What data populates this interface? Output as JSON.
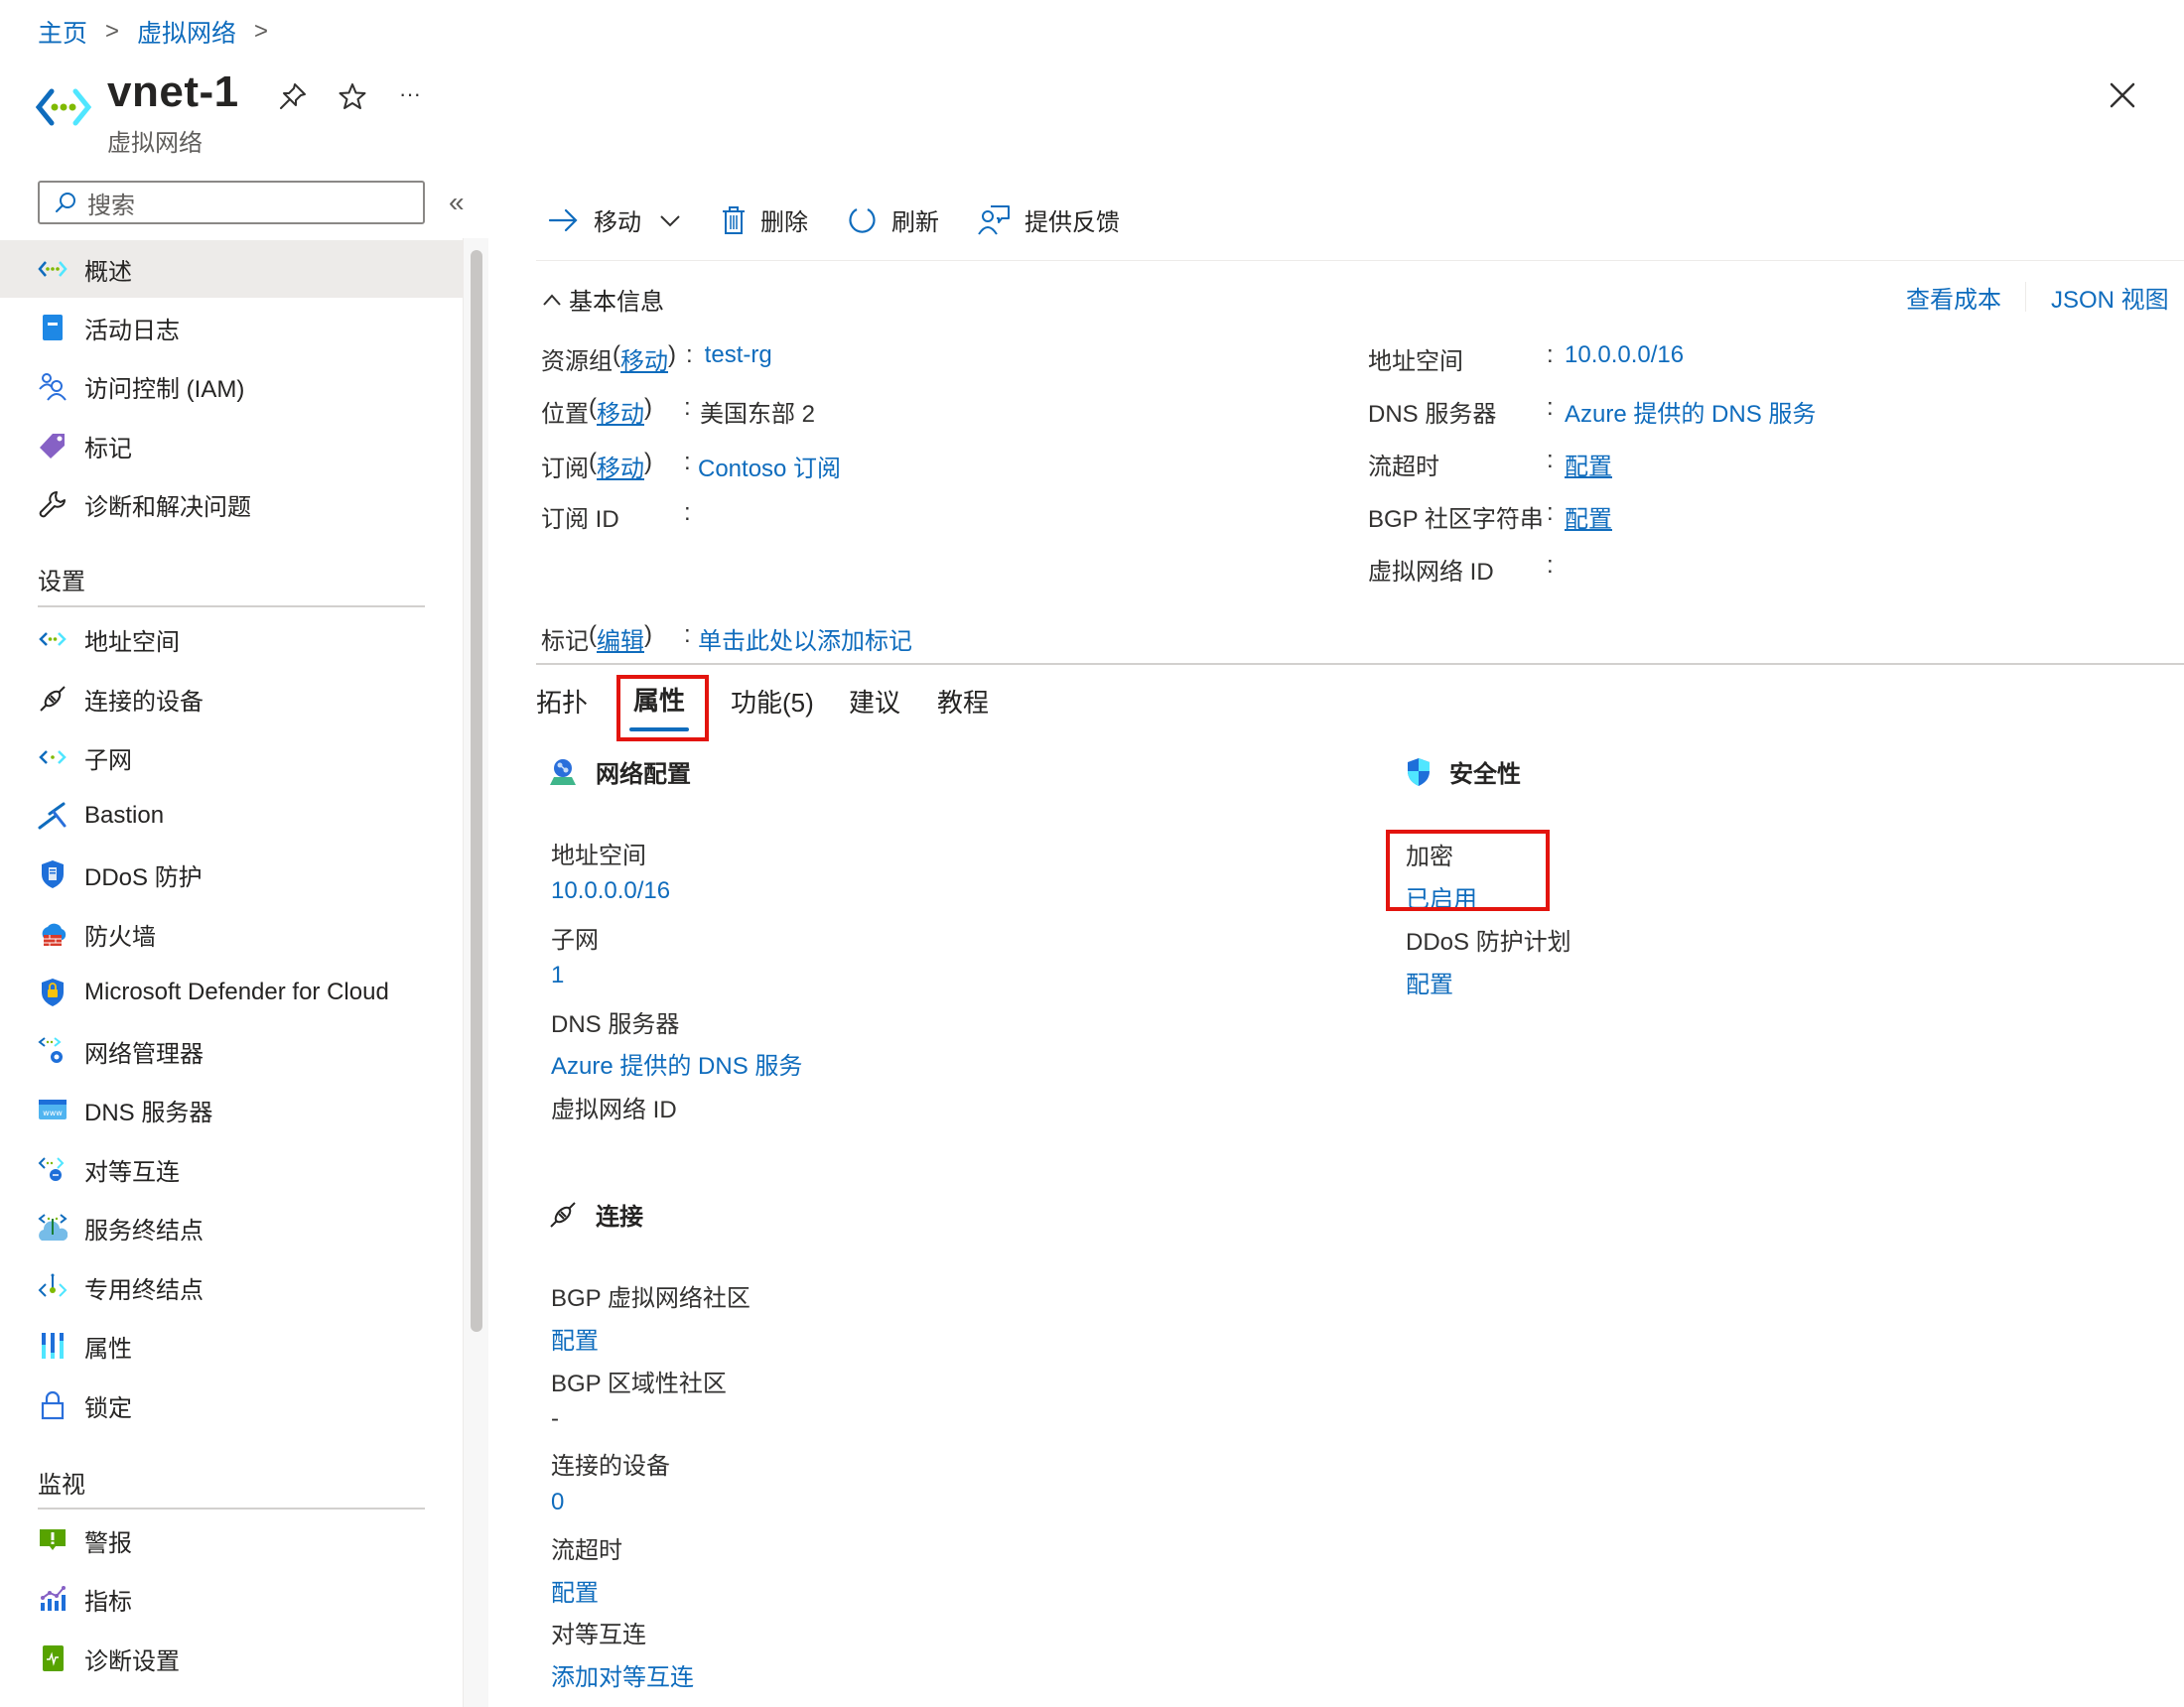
{
  "breadcrumb": [
    {
      "label": "主页"
    },
    {
      "label": "虚拟网络"
    }
  ],
  "header": {
    "title": "vnet-1",
    "subtitle": "虚拟网络",
    "icons": [
      "virtual-network-icon",
      "pin-icon",
      "star-icon",
      "more-icon",
      "close-icon"
    ],
    "more_label": "···"
  },
  "sidebar": {
    "search_placeholder": "搜索",
    "collapse_label": "«",
    "items": [
      {
        "label": "概述",
        "icon": "virtual-network-icon",
        "active": true
      },
      {
        "label": "活动日志",
        "icon": "activity-log-icon"
      },
      {
        "label": "访问控制 (IAM)",
        "icon": "iam-icon"
      },
      {
        "label": "标记",
        "icon": "tag-icon"
      },
      {
        "label": "诊断和解决问题",
        "icon": "wrench-icon"
      }
    ],
    "sections": [
      {
        "title": "设置",
        "items": [
          {
            "label": "地址空间",
            "icon": "address-space-icon"
          },
          {
            "label": "连接的设备",
            "icon": "plug-icon"
          },
          {
            "label": "子网",
            "icon": "subnet-icon"
          },
          {
            "label": "Bastion",
            "icon": "bastion-icon"
          },
          {
            "label": "DDoS 防护",
            "icon": "ddos-shield-icon"
          },
          {
            "label": "防火墙",
            "icon": "firewall-icon"
          },
          {
            "label": "Microsoft Defender for Cloud",
            "icon": "defender-icon"
          },
          {
            "label": "网络管理器",
            "icon": "network-manager-icon"
          },
          {
            "label": "DNS 服务器",
            "icon": "dns-icon"
          },
          {
            "label": "对等互连",
            "icon": "peering-icon"
          },
          {
            "label": "服务终结点",
            "icon": "service-endpoint-icon"
          },
          {
            "label": "专用终结点",
            "icon": "private-endpoint-icon"
          },
          {
            "label": "属性",
            "icon": "properties-icon"
          },
          {
            "label": "锁定",
            "icon": "lock-icon"
          }
        ]
      },
      {
        "title": "监视",
        "items": [
          {
            "label": "警报",
            "icon": "alert-icon"
          },
          {
            "label": "指标",
            "icon": "metrics-icon"
          },
          {
            "label": "诊断设置",
            "icon": "diagnostic-settings-icon"
          }
        ]
      }
    ]
  },
  "toolbar": {
    "move_label": "移动",
    "delete_label": "删除",
    "refresh_label": "刷新",
    "feedback_label": "提供反馈"
  },
  "essentials": {
    "toggle_label": "基本信息",
    "view_cost_label": "查看成本",
    "json_view_label": "JSON 视图",
    "left": [
      {
        "key": "资源组",
        "key_link": "移动",
        "value": "test-rg",
        "value_is_link": true
      },
      {
        "key": "位置",
        "key_link": "移动",
        "value": "美国东部 2",
        "value_is_link": false
      },
      {
        "key": "订阅",
        "key_link": "移动",
        "value": "Contoso 订阅",
        "value_is_link": true
      },
      {
        "key": "订阅 ID",
        "key_link": "",
        "value": "",
        "value_is_link": false
      }
    ],
    "right": [
      {
        "key": "地址空间",
        "value": "10.0.0.0/16",
        "value_is_link": true
      },
      {
        "key": "DNS 服务器",
        "value": "Azure 提供的 DNS 服务",
        "value_is_link": true
      },
      {
        "key": "流超时",
        "value": "配置",
        "value_is_link": true
      },
      {
        "key": "BGP 社区字符串",
        "value": "配置",
        "value_is_link": true
      },
      {
        "key": "虚拟网络 ID",
        "value": "",
        "value_is_link": false
      }
    ],
    "tags": {
      "key": "标记",
      "key_link": "编辑",
      "value": "单击此处以添加标记"
    }
  },
  "tabs": [
    {
      "label": "拓扑"
    },
    {
      "label": "属性",
      "active": true
    },
    {
      "label": "功能(5)"
    },
    {
      "label": "建议"
    },
    {
      "label": "教程"
    }
  ],
  "properties": {
    "network_config": {
      "title": "网络配置",
      "fields": [
        {
          "label": "地址空间",
          "value": "10.0.0.0/16",
          "link": true
        },
        {
          "label": "子网",
          "value": "1",
          "link": true
        },
        {
          "label": "DNS 服务器",
          "value": "Azure 提供的 DNS 服务",
          "link": true
        },
        {
          "label": "虚拟网络 ID",
          "value": "",
          "link": false
        }
      ]
    },
    "security": {
      "title": "安全性",
      "fields": [
        {
          "label": "加密",
          "value": "已启用",
          "link": true
        },
        {
          "label": "DDoS 防护计划",
          "value": "配置",
          "link": true
        }
      ]
    },
    "connectivity": {
      "title": "连接",
      "fields": [
        {
          "label": "BGP 虚拟网络社区",
          "value": "配置",
          "link": true
        },
        {
          "label": "BGP 区域性社区",
          "value": "-",
          "link": false
        },
        {
          "label": "连接的设备",
          "value": "0",
          "link": true
        },
        {
          "label": "流超时",
          "value": "配置",
          "link": true
        },
        {
          "label": "对等互连",
          "value": "添加对等互连",
          "link": true
        }
      ]
    }
  },
  "colors": {
    "accent": "#0f6cbd",
    "highlight_box": "#e3140e",
    "active_nav_bg": "#edebe9"
  }
}
